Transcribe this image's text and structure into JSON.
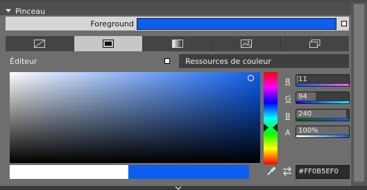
{
  "section": {
    "title": "Pinceau"
  },
  "property": {
    "label": "Foreground",
    "color": "#0b5ef0"
  },
  "brush_tabs": [
    {
      "name": "no-brush",
      "icon": "no-brush-icon",
      "active": false
    },
    {
      "name": "solid-color",
      "icon": "solid-color-icon",
      "active": true
    },
    {
      "name": "gradient",
      "icon": "gradient-icon",
      "active": false
    },
    {
      "name": "image",
      "icon": "image-brush-icon",
      "active": false
    },
    {
      "name": "resource",
      "icon": "resource-brush-icon",
      "active": false
    }
  ],
  "editor": {
    "tabs": {
      "editor": "Éditeur",
      "resources": "Ressources de couleur"
    }
  },
  "channels": {
    "r": {
      "label": "R",
      "value": "11",
      "fraction": 0.043
    },
    "g": {
      "label": "G",
      "value": "94",
      "fraction": 0.369
    },
    "b": {
      "label": "B",
      "value": "240",
      "fraction": 0.941
    },
    "a": {
      "label": "A",
      "value": "100%",
      "fraction": 1.0
    }
  },
  "hex": {
    "value": "#FF0B5EF0"
  },
  "colors": {
    "current": "#0b5ef0",
    "previous": "#ffffff",
    "accent": "#0b5ef0"
  }
}
